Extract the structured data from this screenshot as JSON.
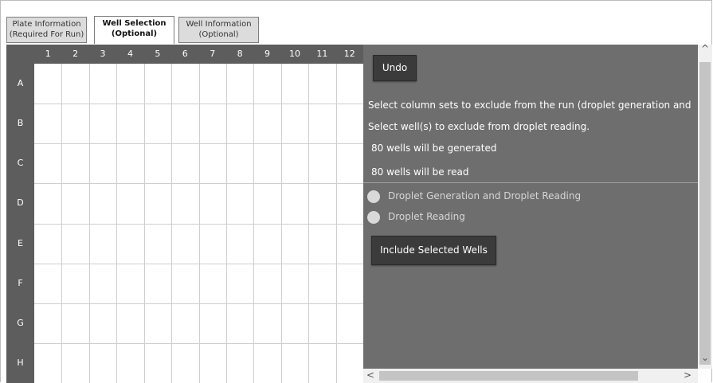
{
  "tabs": [
    {
      "line1": "Plate Information",
      "line2": "(Required For Run)"
    },
    {
      "line1": "Well Selection",
      "line2": "(Optional)"
    },
    {
      "line1": "Well Information",
      "line2": "(Optional)"
    }
  ],
  "plate": {
    "columns": [
      "1",
      "2",
      "3",
      "4",
      "5",
      "6",
      "7",
      "8",
      "9",
      "10",
      "11",
      "12"
    ],
    "rows": [
      "A",
      "B",
      "C",
      "D",
      "E",
      "F",
      "G",
      "H"
    ]
  },
  "panel": {
    "undo_label": "Undo",
    "instruction_1": "Select column sets to exclude from the run (droplet generation and",
    "instruction_2": "Select well(s) to exclude from droplet reading.",
    "generated_text": "80 wells will be generated",
    "read_text": "80 wells will be read",
    "radio_1": "Droplet Generation and Droplet Reading",
    "radio_2": "Droplet Reading",
    "include_label": "Include Selected Wells"
  },
  "icons": {
    "scroll_up": "chevron-up-icon",
    "scroll_down": "chevron-down-icon",
    "scroll_left": "chevron-left-icon",
    "scroll_right": "chevron-right-icon"
  }
}
